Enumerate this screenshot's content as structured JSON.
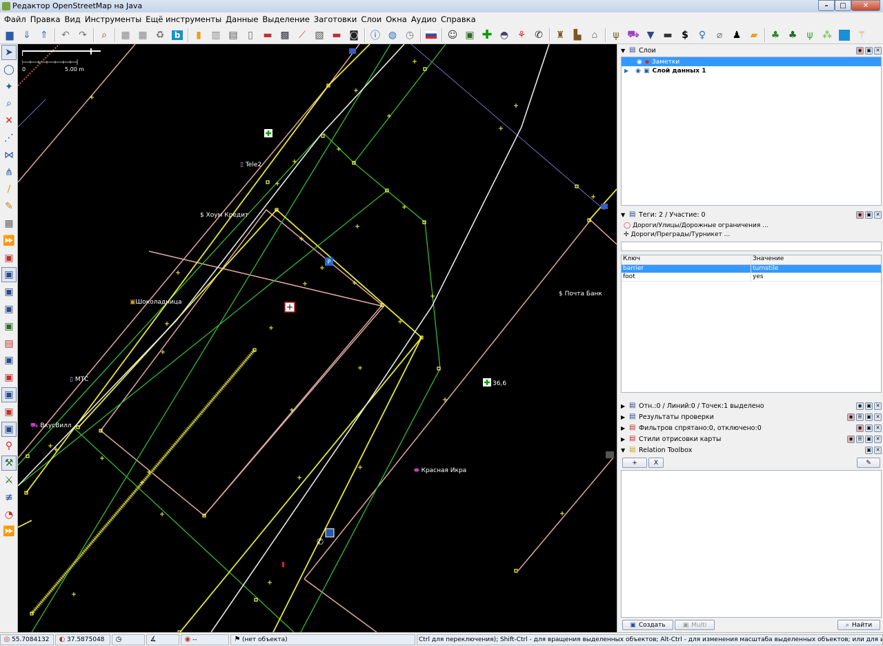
{
  "window": {
    "title": "Редактор OpenStreetMap на Java",
    "min": "–",
    "max": "□",
    "close": "✕"
  },
  "menu": [
    "Файл",
    "Правка",
    "Вид",
    "Инструменты",
    "Ещё инструменты",
    "Данные",
    "Выделение",
    "Заготовки",
    "Слои",
    "Окна",
    "Аудио",
    "Справка"
  ],
  "toolbar_icons": [
    "open-file-icon",
    "download-icon",
    "upload-icon",
    "undo-icon",
    "redo-icon",
    "preferences-icon",
    "zoom-icon",
    "building-icon",
    "reverse-way-icon",
    "recycle-icon",
    "bing-icon",
    "tag-icon",
    "road-icon",
    "highway-icon",
    "barrier-icon",
    "railway-icon",
    "bridge-icon",
    "fence-icon",
    "pattern-icon",
    "car-icon",
    "info-icon",
    "globe-icon",
    "clock-icon",
    "flag-icon",
    "theatre-icon",
    "amenity-icon",
    "pharmacy-icon",
    "food-icon",
    "balloons-icon",
    "phone-icon",
    "castle-icon",
    "factory-icon",
    "house-icon",
    "cutlery-icon",
    "shop-cart-icon",
    "shirt-icon",
    "bus-icon",
    "dollar-icon",
    "toilets-icon",
    "paperclip-icon",
    "person-icon",
    "bag-icon",
    "tree-icon",
    "forest-icon",
    "grass-icon",
    "meadow-icon",
    "water-icon",
    "wheat-icon"
  ],
  "left_tools": [
    "select-tool-icon",
    "lasso-icon",
    "draw-node-icon",
    "zoom-tool-icon",
    "delete-icon",
    "split-way-icon",
    "combine-icon",
    "join-icon",
    "draw-icon",
    "pencil-icon",
    "building-tool-icon",
    "more-icon",
    "layer-tool-1-icon",
    "layer-tool-2-icon",
    "layer-tool-3-icon",
    "layer-tool-4-icon",
    "layer-tool-5-icon",
    "layer-tool-6-icon",
    "layer-tool-7-icon",
    "layer-tool-8-icon",
    "layer-tool-9-icon",
    "layer-tool-10-icon",
    "layer-tool-11-icon",
    "map-marker-icon",
    "tool-a-icon",
    "tool-b-icon",
    "tool-c-icon",
    "speed-icon",
    "more2-icon"
  ],
  "map": {
    "scale": {
      "start": "0",
      "end": "5.00 m"
    },
    "labels": {
      "tele2": "Tele2",
      "home_credit": "Хоум Кредит",
      "shokoladnica": "Шоколадница",
      "mts": "МТС",
      "vkusvill": "ВкусВилл",
      "pochta": "Почта Банк",
      "krasnaya": "Красная Икра",
      "num": "36,6"
    }
  },
  "layers": {
    "title": "Слои",
    "items": [
      {
        "name": "Заметки",
        "selected": true
      },
      {
        "name": "Слой данных 1",
        "selected": false
      }
    ]
  },
  "tags": {
    "title": "Теги: 2 / Участие: 0",
    "presets": [
      "Дороги/Улицы/Дорожные ограничения ...",
      "Дороги/Преграды/Турникет ..."
    ],
    "col_key": "Ключ",
    "col_value": "Значение",
    "rows": [
      {
        "key": "barrier",
        "value": "turnstile",
        "selected": true
      },
      {
        "key": "foot",
        "value": "yes",
        "selected": false
      }
    ]
  },
  "collapsed_panels": [
    "Отн.:0 / Линий:0 / Точек:1 выделено",
    "Результаты проверки",
    "Фильтров спрятано:0, отключено:0",
    "Стили отрисовки карты"
  ],
  "relation_toolbox": {
    "title": "Relation Toolbox",
    "add": "+",
    "clear": "X",
    "edit": "✎"
  },
  "bottom_buttons": {
    "create": "Создать",
    "multi": "Multi",
    "find": "Найти"
  },
  "status": {
    "lat": "55.7084132",
    "lon": "37.5875048",
    "heading": "",
    "angle": "",
    "dist": "--",
    "object": "(нет объекта)",
    "help": "Ctrl для переключения); Shift-Ctrl - для вращения выделенных объектов; Alt-Ctrl - для изменения масштаба выделенных объектов; или для изменения выделения"
  },
  "colors": {
    "map_bg": "#000000",
    "green": "#33cc33",
    "yellow": "#ffff33",
    "pink": "#e0a0a0",
    "white": "#ffffff",
    "selection": "#3399ff"
  }
}
